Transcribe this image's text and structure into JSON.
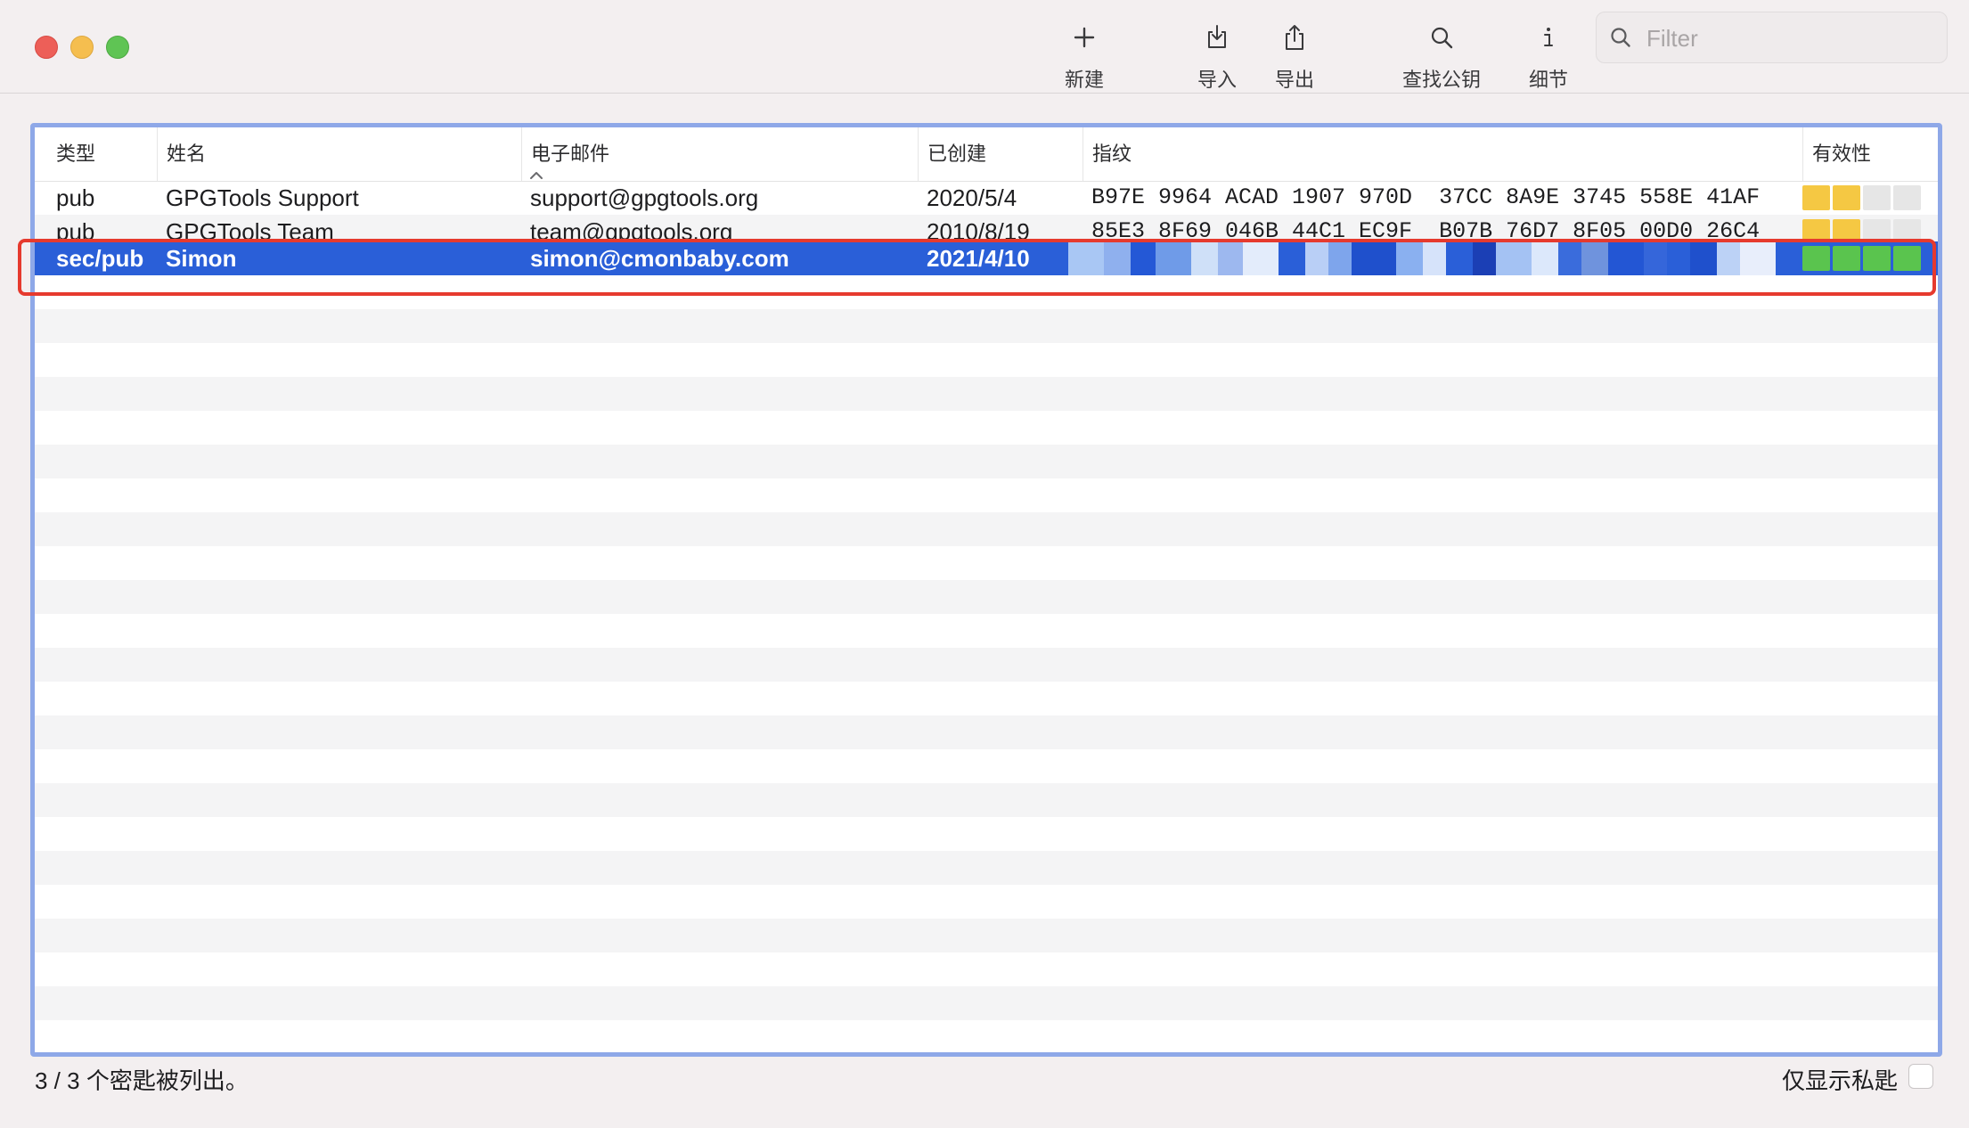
{
  "toolbar": {
    "new_label": "新建",
    "import_label": "导入",
    "export_label": "导出",
    "lookup_label": "查找公钥",
    "details_label": "细节",
    "filter_placeholder": "Filter"
  },
  "table": {
    "columns": [
      "类型",
      "姓名",
      "电子邮件",
      "已创建",
      "指纹",
      "有效性"
    ],
    "sort_column": "姓名",
    "rows": [
      {
        "type": "pub",
        "name": "GPGTools Support",
        "email": "support@gpgtools.org",
        "created": "2020/5/4",
        "fingerprint": "B97E 9964 ACAD 1907 970D  37CC 8A9E 3745 558E 41AF",
        "validity": "partial",
        "selected": false
      },
      {
        "type": "pub",
        "name": "GPGTools Team",
        "email": "team@gpgtools.org",
        "created": "2010/8/19",
        "fingerprint": "85E3 8F69 046B 44C1 EC9F  B07B 76D7 8F05 00D0 26C4",
        "validity": "partial",
        "selected": false
      },
      {
        "type": "sec/pub",
        "name": "Simon",
        "email": "simon@cmonbaby.com",
        "created": "2021/4/10",
        "fingerprint": "",
        "validity": "full",
        "selected": true
      }
    ]
  },
  "footer": {
    "count_text": "3 / 3 个密匙被列出。",
    "secret_only_label": "仅显示私匙"
  },
  "colors": {
    "selection": "#2a5fd8",
    "validity_partial": "#f5c843",
    "validity_full": "#5ac44e",
    "highlight": "#e63a2e",
    "table_border": "#8ea8e8"
  }
}
